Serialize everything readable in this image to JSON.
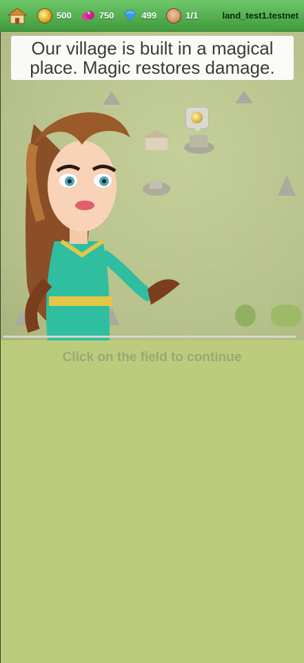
{
  "topbar": {
    "home_icon": "village-house-icon",
    "resources": [
      {
        "icon": "gold-coin-icon",
        "value": "500"
      },
      {
        "icon": "pink-gem-icon",
        "value": "750"
      },
      {
        "icon": "blue-diamond-icon",
        "value": "499"
      },
      {
        "icon": "population-face-icon",
        "value": "1/1"
      }
    ],
    "account": "land_test1.testnet"
  },
  "tutorial": {
    "message": "Our village is built in a magical place. Magic restores damage.",
    "continue_prompt": "Click on the field to continue"
  },
  "colors": {
    "topbar": "#4fb14b",
    "field": "#bccc7c",
    "character_dress": "#2fbfa0"
  }
}
